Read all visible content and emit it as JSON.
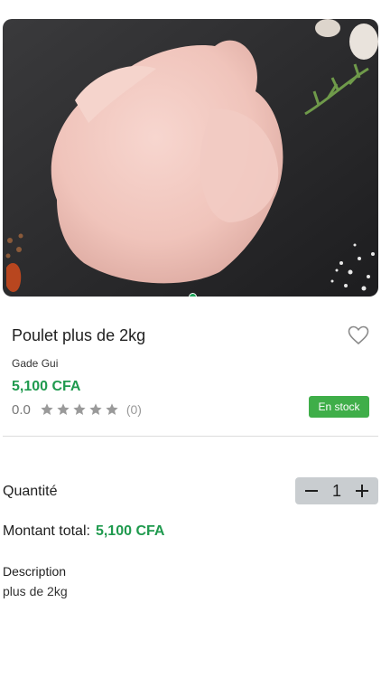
{
  "product": {
    "image_alt": "chicken-photo",
    "title": "Poulet plus de 2kg",
    "vendor": "Gade Gui",
    "price": "5,100 CFA",
    "rating_value": "0.0",
    "rating_stars": 0,
    "rating_count": "(0)",
    "stock_badge": "En stock",
    "image_index": 1,
    "image_count": 1
  },
  "quantity": {
    "label": "Quantité",
    "minus_icon": "minus-icon",
    "value": "1",
    "plus_icon": "plus-icon"
  },
  "total": {
    "label": "Montant total:",
    "value": "5,100 CFA"
  },
  "description": {
    "label": "Description",
    "text": "plus de 2kg"
  },
  "colors": {
    "accent_green": "#1f9a4e",
    "stock_green": "#3fae49",
    "stepper_bg": "#c9cdd0"
  },
  "icons": {
    "favorite": "heart-outline-icon",
    "star": "star-icon"
  }
}
